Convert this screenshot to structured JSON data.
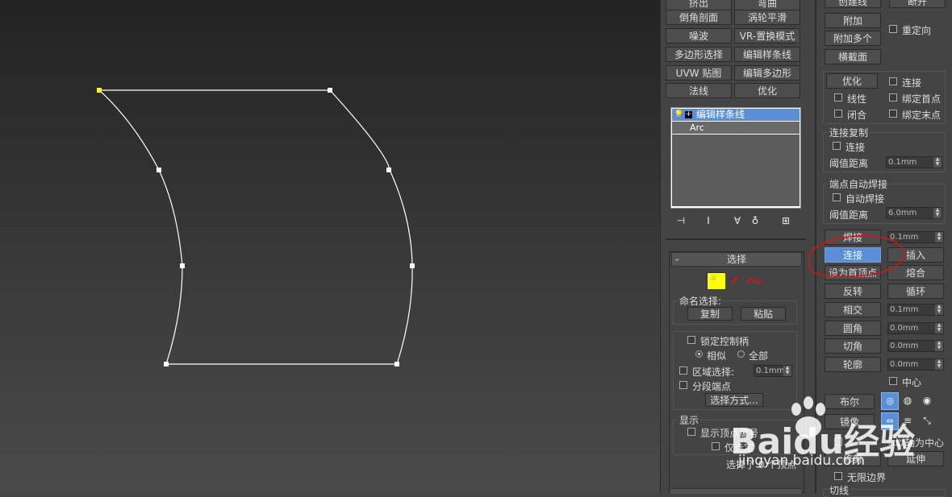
{
  "modifier_buttons": [
    [
      "挤出",
      "弯曲"
    ],
    [
      "倒角剖面",
      "涡轮平滑"
    ],
    [
      "噪波",
      "VR-置换模式"
    ],
    [
      "多边形选择",
      "编辑样条线"
    ],
    [
      "UVW 贴图",
      "编辑多边形"
    ],
    [
      "法线",
      "优化"
    ]
  ],
  "stack": {
    "items": [
      {
        "label": "编辑样条线",
        "selected": true
      },
      {
        "label": "Arc",
        "selected": false
      }
    ],
    "toolbar_icons": [
      "pin-stack-icon",
      "show-end-result-icon",
      "make-unique-icon",
      "remove-modifier-icon",
      "configure-modifier-sets-icon"
    ]
  },
  "selection_rollout": {
    "title": "选择",
    "collapse_glyph": "-",
    "named_label": "命名选择:",
    "copy": "复制",
    "paste": "粘贴",
    "lock_handles": "锁定控制柄",
    "radio_alike": "相似",
    "radio_all": "全部",
    "area_select": "区域选择:",
    "area_value": "0.1mm",
    "segment_end": "分段端点",
    "select_by": "选择方式...",
    "display_label": "显示",
    "show_vertex_numbers": "显示顶点编号",
    "selected_only": "仅选定",
    "selected_status": "选择了 0 个顶点"
  },
  "geometry": {
    "top_buttons": {
      "create_line": "创建线",
      "break": "断开",
      "attach": "附加",
      "attach_multi": "附加多个",
      "cross_section": "横截面",
      "reorient": "重定向"
    },
    "refine": "优化",
    "connect": "连接",
    "linear": "线性",
    "bind_first": "绑定首点",
    "closed": "闭合",
    "bind_last": "绑定末点",
    "connect_copy_label": "连接复制",
    "connect_copy_chk": "连接",
    "threshold": "阈值距离",
    "threshold_val": "0.1mm",
    "auto_weld_label": "端点自动焊接",
    "auto_weld": "自动焊接",
    "auto_threshold": "阈值距离",
    "auto_threshold_val": "6.0mm",
    "weld": "焊接",
    "weld_val": "0.1mm",
    "connect_btn": "连接",
    "insert": "插入",
    "make_first": "设为首顶点",
    "fuse": "熔合",
    "reverse": "反转",
    "cycle": "循环",
    "cross_insert": "相交",
    "cross_val": "0.1mm",
    "fillet": "圆角",
    "fillet_val": "0.0mm",
    "chamfer": "切角",
    "chamfer_val": "0.0mm",
    "outline": "轮廓",
    "outline_val": "0.0mm",
    "center": "中心",
    "boolean": "布尔",
    "mirror": "镜像",
    "mirror_axis": "以轴为中心",
    "trim": "修剪",
    "extend": "延伸",
    "infinite": "无限边界",
    "tangent_label": "切线"
  },
  "watermark": {
    "brand": "Baidu经验",
    "url": "jingyan.baidu.com"
  },
  "colors": {
    "accent": "#5a8fd8",
    "annotation": "#dd1111",
    "vertex_first": "#ffff00"
  }
}
